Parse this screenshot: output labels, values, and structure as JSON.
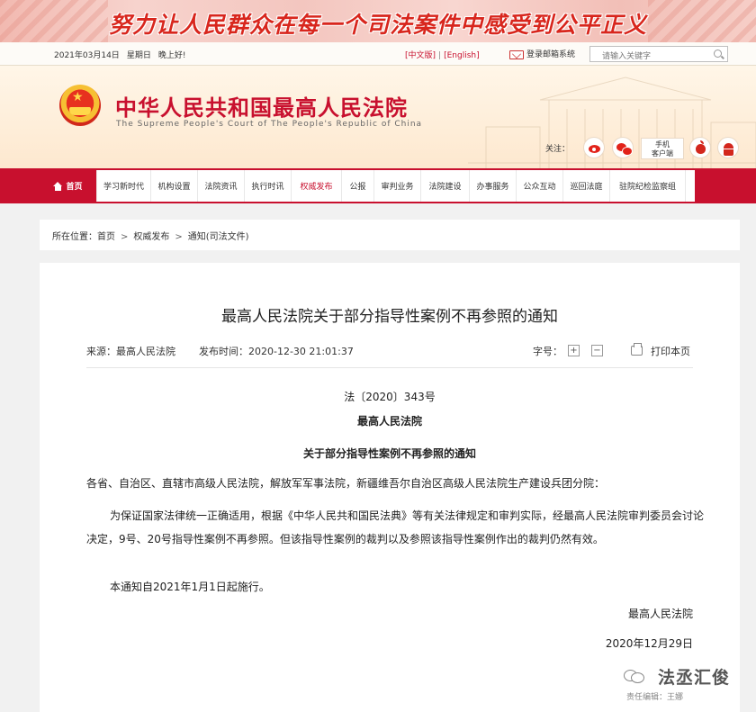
{
  "banner": {
    "slogan": "努力让人民群众在每一个司法案件中感受到公平正义"
  },
  "topbar": {
    "date": "2021年03月14日",
    "weekday": "星期日",
    "greeting": "晚上好!",
    "lang_cn": "[中文版]",
    "lang_sep": "|",
    "lang_en": "[English]",
    "mail_login": "登录邮箱系统",
    "search_placeholder": "请输入关键字"
  },
  "header": {
    "title": "中华人民共和国最高人民法院",
    "subtitle": "The Supreme People's Court of The People's Republic of China",
    "follow_label": "关注：",
    "mobile_client_line1": "手机",
    "mobile_client_line2": "客户端"
  },
  "nav": {
    "items": [
      "首页",
      "学习新时代",
      "机构设置",
      "法院资讯",
      "执行时讯",
      "权威发布",
      "公报",
      "审判业务",
      "法院建设",
      "办事服务",
      "公众互动",
      "巡回法庭",
      "驻院纪检监察组"
    ],
    "active_index": 5
  },
  "breadcrumb": {
    "prefix": "所在位置：",
    "items": [
      "首页",
      "权威发布",
      "通知(司法文件)"
    ]
  },
  "article": {
    "title": "最高人民法院关于部分指导性案例不再参照的通知",
    "source": "来源：最高人民法院",
    "published": "发布时间：2020-12-30 21:01:37",
    "font_size_label": "字号：",
    "font_plus": "+",
    "font_minus": "−",
    "print_label": "打印本页",
    "doc_number": "法〔2020〕343号",
    "issuer": "最高人民法院",
    "notice_title": "关于部分指导性案例不再参照的通知",
    "addressee": "各省、自治区、直辖市高级人民法院，解放军军事法院，新疆维吾尔自治区高级人民法院生产建设兵团分院：",
    "body": "为保证国家法律统一正确适用，根据《中华人民共和国民法典》等有关法律规定和审判实际，经最高人民法院审判委员会讨论决定，9号、20号指导性案例不再参照。但该指导性案例的裁判以及参照该指导性案例作出的裁判仍然有效。",
    "effective": "本通知自2021年1月1日起施行。",
    "sign_org": "最高人民法院",
    "sign_date": "2020年12月29日"
  },
  "watermark": {
    "account": "法丞汇俊",
    "editor": "责任编辑：王娜"
  },
  "colors": {
    "brand_red": "#c8102e",
    "header_bg": "#fde8cf",
    "page_bg": "#f1f1f1"
  }
}
